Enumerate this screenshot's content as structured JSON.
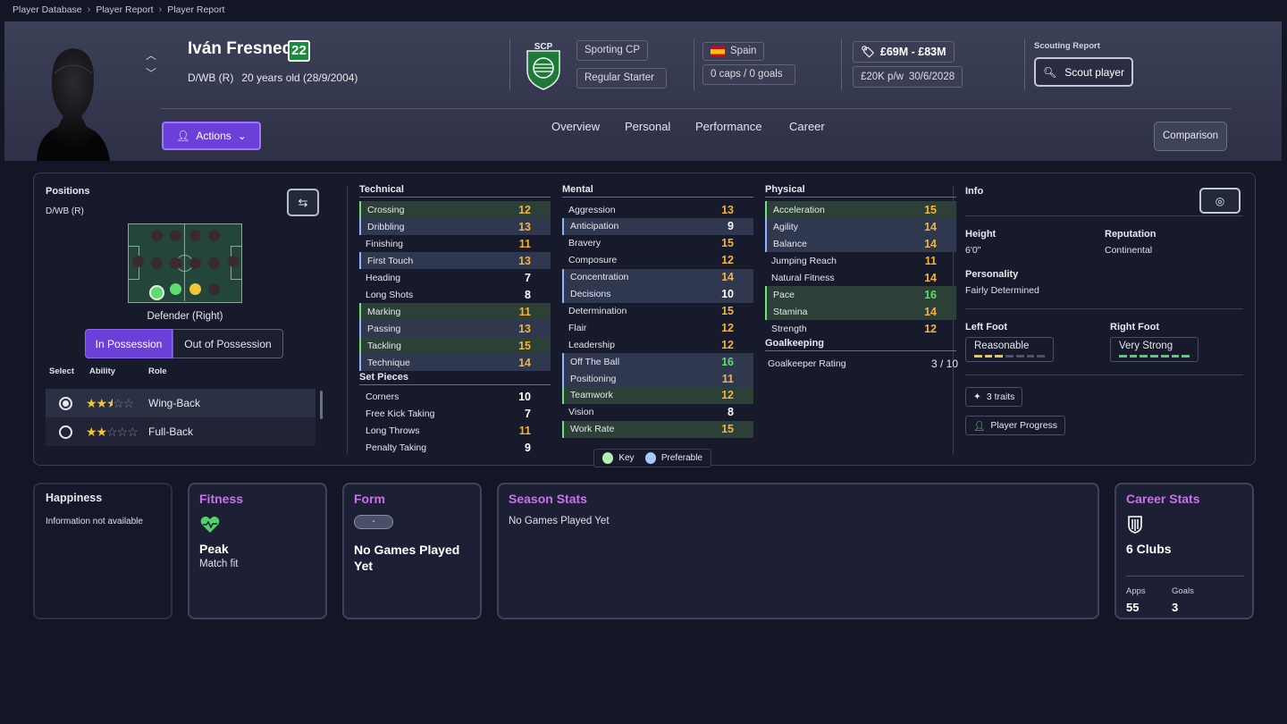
{
  "breadcrumb": [
    "Player Database",
    "Player Report",
    "Player Report"
  ],
  "player": {
    "name": "Iván Fresneda",
    "number": "22",
    "position": "D/WB (R)",
    "age_text": "20 years old (28/9/2004)"
  },
  "club": {
    "name": "Sporting CP",
    "status": "Regular Starter",
    "badge_text": "SCP"
  },
  "nation": {
    "name": "Spain",
    "caps": "0 caps / 0 goals"
  },
  "value": {
    "range": "£69M - £83M",
    "wage": "£20K p/w",
    "contract_end": "30/6/2028"
  },
  "scouting": {
    "label": "Scouting Report",
    "button": "Scout player"
  },
  "actions_label": "Actions",
  "tabs": [
    "Overview",
    "Personal",
    "Performance",
    "Career"
  ],
  "comparison_label": "Comparison",
  "positions": {
    "title": "Positions",
    "current": "D/WB (R)",
    "pitch_label": "Defender (Right)",
    "toggle": [
      "In Possession",
      "Out of Possession"
    ],
    "table_headers": [
      "Select",
      "Ability",
      "Role"
    ],
    "roles": [
      {
        "name": "Wing-Back",
        "stars": 2.5,
        "selected": true
      },
      {
        "name": "Full-Back",
        "stars": 2,
        "selected": false
      }
    ]
  },
  "technical": {
    "title": "Technical",
    "items": [
      {
        "name": "Crossing",
        "value": "12",
        "mark": "k",
        "color": "#f2b43a"
      },
      {
        "name": "Dribbling",
        "value": "13",
        "mark": "p",
        "color": "#f2b43a"
      },
      {
        "name": "Finishing",
        "value": "11",
        "mark": "",
        "color": "#f2b43a"
      },
      {
        "name": "First Touch",
        "value": "13",
        "mark": "p",
        "color": "#f2b43a"
      },
      {
        "name": "Heading",
        "value": "7",
        "mark": "",
        "color": "#ffffff"
      },
      {
        "name": "Long Shots",
        "value": "8",
        "mark": "",
        "color": "#ffffff"
      },
      {
        "name": "Marking",
        "value": "11",
        "mark": "k",
        "color": "#f2b43a"
      },
      {
        "name": "Passing",
        "value": "13",
        "mark": "p",
        "color": "#f2b43a"
      },
      {
        "name": "Tackling",
        "value": "15",
        "mark": "k",
        "color": "#f2b43a"
      },
      {
        "name": "Technique",
        "value": "14",
        "mark": "p",
        "color": "#f2b43a"
      }
    ]
  },
  "set_pieces": {
    "title": "Set Pieces",
    "items": [
      {
        "name": "Corners",
        "value": "10",
        "mark": "",
        "color": "#ffffff"
      },
      {
        "name": "Free Kick Taking",
        "value": "7",
        "mark": "",
        "color": "#ffffff"
      },
      {
        "name": "Long Throws",
        "value": "11",
        "mark": "",
        "color": "#f2b43a"
      },
      {
        "name": "Penalty Taking",
        "value": "9",
        "mark": "",
        "color": "#ffffff"
      }
    ]
  },
  "mental": {
    "title": "Mental",
    "items": [
      {
        "name": "Aggression",
        "value": "13",
        "mark": "",
        "color": "#f2b43a"
      },
      {
        "name": "Anticipation",
        "value": "9",
        "mark": "p",
        "color": "#ffffff"
      },
      {
        "name": "Bravery",
        "value": "15",
        "mark": "",
        "color": "#f2b43a"
      },
      {
        "name": "Composure",
        "value": "12",
        "mark": "",
        "color": "#f2b43a"
      },
      {
        "name": "Concentration",
        "value": "14",
        "mark": "p",
        "color": "#f2b43a"
      },
      {
        "name": "Decisions",
        "value": "10",
        "mark": "p",
        "color": "#ffffff"
      },
      {
        "name": "Determination",
        "value": "15",
        "mark": "",
        "color": "#f2b43a"
      },
      {
        "name": "Flair",
        "value": "12",
        "mark": "",
        "color": "#f2b43a"
      },
      {
        "name": "Leadership",
        "value": "12",
        "mark": "",
        "color": "#f2b43a"
      },
      {
        "name": "Off The Ball",
        "value": "16",
        "mark": "p",
        "color": "#5fdc6a"
      },
      {
        "name": "Positioning",
        "value": "11",
        "mark": "p",
        "color": "#f2b43a"
      },
      {
        "name": "Teamwork",
        "value": "12",
        "mark": "k",
        "color": "#f2b43a"
      },
      {
        "name": "Vision",
        "value": "8",
        "mark": "",
        "color": "#ffffff"
      },
      {
        "name": "Work Rate",
        "value": "15",
        "mark": "k",
        "color": "#f2b43a"
      }
    ]
  },
  "physical": {
    "title": "Physical",
    "items": [
      {
        "name": "Acceleration",
        "value": "15",
        "mark": "k",
        "color": "#f2b43a"
      },
      {
        "name": "Agility",
        "value": "14",
        "mark": "p",
        "color": "#f2b43a"
      },
      {
        "name": "Balance",
        "value": "14",
        "mark": "p",
        "color": "#f2b43a"
      },
      {
        "name": "Jumping Reach",
        "value": "11",
        "mark": "",
        "color": "#f2b43a"
      },
      {
        "name": "Natural Fitness",
        "value": "14",
        "mark": "",
        "color": "#f2b43a"
      },
      {
        "name": "Pace",
        "value": "16",
        "mark": "k",
        "color": "#5fdc6a"
      },
      {
        "name": "Stamina",
        "value": "14",
        "mark": "k",
        "color": "#f2b43a"
      },
      {
        "name": "Strength",
        "value": "12",
        "mark": "",
        "color": "#f2b43a"
      }
    ]
  },
  "goalkeeping": {
    "title": "Goalkeeping",
    "label": "Goalkeeper Rating",
    "value": "3 / 10"
  },
  "legend": {
    "key": "Key",
    "preferable": "Preferable"
  },
  "info": {
    "title": "Info",
    "height_label": "Height",
    "height": "6'0\"",
    "reputation_label": "Reputation",
    "reputation": "Continental",
    "personality_label": "Personality",
    "personality": "Fairly Determined",
    "left_foot_label": "Left Foot",
    "left_foot": "Reasonable",
    "left_foot_level": 3,
    "right_foot_label": "Right Foot",
    "right_foot": "Very Strong",
    "right_foot_level": 7,
    "traits": "3 traits",
    "progress": "Player Progress"
  },
  "cards": {
    "happiness": {
      "title": "Happiness",
      "text": "Information not available"
    },
    "fitness": {
      "title": "Fitness",
      "status": "Peak",
      "sub": "Match fit"
    },
    "form": {
      "title": "Form",
      "pill": "-",
      "text": "No Games Played Yet"
    },
    "season": {
      "title": "Season Stats",
      "text": "No Games Played Yet"
    },
    "career": {
      "title": "Career Stats",
      "clubs": "6 Clubs",
      "apps_label": "Apps",
      "apps": "55",
      "goals_label": "Goals",
      "goals": "3"
    }
  }
}
